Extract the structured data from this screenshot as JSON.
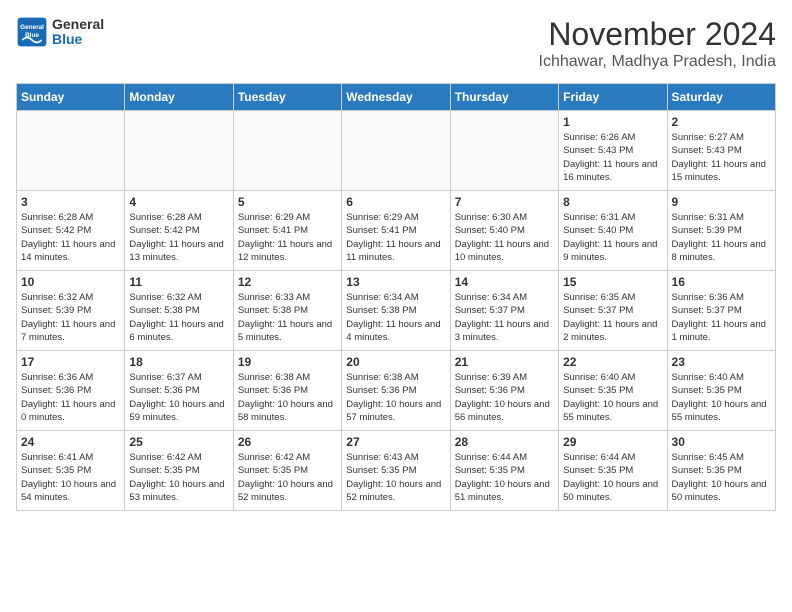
{
  "logo": {
    "line1": "General",
    "line2": "Blue"
  },
  "title": "November 2024",
  "location": "Ichhawar, Madhya Pradesh, India",
  "weekdays": [
    "Sunday",
    "Monday",
    "Tuesday",
    "Wednesday",
    "Thursday",
    "Friday",
    "Saturday"
  ],
  "weeks": [
    [
      {
        "day": "",
        "info": ""
      },
      {
        "day": "",
        "info": ""
      },
      {
        "day": "",
        "info": ""
      },
      {
        "day": "",
        "info": ""
      },
      {
        "day": "",
        "info": ""
      },
      {
        "day": "1",
        "info": "Sunrise: 6:26 AM\nSunset: 5:43 PM\nDaylight: 11 hours\nand 16 minutes."
      },
      {
        "day": "2",
        "info": "Sunrise: 6:27 AM\nSunset: 5:43 PM\nDaylight: 11 hours\nand 15 minutes."
      }
    ],
    [
      {
        "day": "3",
        "info": "Sunrise: 6:28 AM\nSunset: 5:42 PM\nDaylight: 11 hours\nand 14 minutes."
      },
      {
        "day": "4",
        "info": "Sunrise: 6:28 AM\nSunset: 5:42 PM\nDaylight: 11 hours\nand 13 minutes."
      },
      {
        "day": "5",
        "info": "Sunrise: 6:29 AM\nSunset: 5:41 PM\nDaylight: 11 hours\nand 12 minutes."
      },
      {
        "day": "6",
        "info": "Sunrise: 6:29 AM\nSunset: 5:41 PM\nDaylight: 11 hours\nand 11 minutes."
      },
      {
        "day": "7",
        "info": "Sunrise: 6:30 AM\nSunset: 5:40 PM\nDaylight: 11 hours\nand 10 minutes."
      },
      {
        "day": "8",
        "info": "Sunrise: 6:31 AM\nSunset: 5:40 PM\nDaylight: 11 hours\nand 9 minutes."
      },
      {
        "day": "9",
        "info": "Sunrise: 6:31 AM\nSunset: 5:39 PM\nDaylight: 11 hours\nand 8 minutes."
      }
    ],
    [
      {
        "day": "10",
        "info": "Sunrise: 6:32 AM\nSunset: 5:39 PM\nDaylight: 11 hours\nand 7 minutes."
      },
      {
        "day": "11",
        "info": "Sunrise: 6:32 AM\nSunset: 5:38 PM\nDaylight: 11 hours\nand 6 minutes."
      },
      {
        "day": "12",
        "info": "Sunrise: 6:33 AM\nSunset: 5:38 PM\nDaylight: 11 hours\nand 5 minutes."
      },
      {
        "day": "13",
        "info": "Sunrise: 6:34 AM\nSunset: 5:38 PM\nDaylight: 11 hours\nand 4 minutes."
      },
      {
        "day": "14",
        "info": "Sunrise: 6:34 AM\nSunset: 5:37 PM\nDaylight: 11 hours\nand 3 minutes."
      },
      {
        "day": "15",
        "info": "Sunrise: 6:35 AM\nSunset: 5:37 PM\nDaylight: 11 hours\nand 2 minutes."
      },
      {
        "day": "16",
        "info": "Sunrise: 6:36 AM\nSunset: 5:37 PM\nDaylight: 11 hours\nand 1 minute."
      }
    ],
    [
      {
        "day": "17",
        "info": "Sunrise: 6:36 AM\nSunset: 5:36 PM\nDaylight: 11 hours\nand 0 minutes."
      },
      {
        "day": "18",
        "info": "Sunrise: 6:37 AM\nSunset: 5:36 PM\nDaylight: 10 hours\nand 59 minutes."
      },
      {
        "day": "19",
        "info": "Sunrise: 6:38 AM\nSunset: 5:36 PM\nDaylight: 10 hours\nand 58 minutes."
      },
      {
        "day": "20",
        "info": "Sunrise: 6:38 AM\nSunset: 5:36 PM\nDaylight: 10 hours\nand 57 minutes."
      },
      {
        "day": "21",
        "info": "Sunrise: 6:39 AM\nSunset: 5:36 PM\nDaylight: 10 hours\nand 56 minutes."
      },
      {
        "day": "22",
        "info": "Sunrise: 6:40 AM\nSunset: 5:35 PM\nDaylight: 10 hours\nand 55 minutes."
      },
      {
        "day": "23",
        "info": "Sunrise: 6:40 AM\nSunset: 5:35 PM\nDaylight: 10 hours\nand 55 minutes."
      }
    ],
    [
      {
        "day": "24",
        "info": "Sunrise: 6:41 AM\nSunset: 5:35 PM\nDaylight: 10 hours\nand 54 minutes."
      },
      {
        "day": "25",
        "info": "Sunrise: 6:42 AM\nSunset: 5:35 PM\nDaylight: 10 hours\nand 53 minutes."
      },
      {
        "day": "26",
        "info": "Sunrise: 6:42 AM\nSunset: 5:35 PM\nDaylight: 10 hours\nand 52 minutes."
      },
      {
        "day": "27",
        "info": "Sunrise: 6:43 AM\nSunset: 5:35 PM\nDaylight: 10 hours\nand 52 minutes."
      },
      {
        "day": "28",
        "info": "Sunrise: 6:44 AM\nSunset: 5:35 PM\nDaylight: 10 hours\nand 51 minutes."
      },
      {
        "day": "29",
        "info": "Sunrise: 6:44 AM\nSunset: 5:35 PM\nDaylight: 10 hours\nand 50 minutes."
      },
      {
        "day": "30",
        "info": "Sunrise: 6:45 AM\nSunset: 5:35 PM\nDaylight: 10 hours\nand 50 minutes."
      }
    ]
  ]
}
